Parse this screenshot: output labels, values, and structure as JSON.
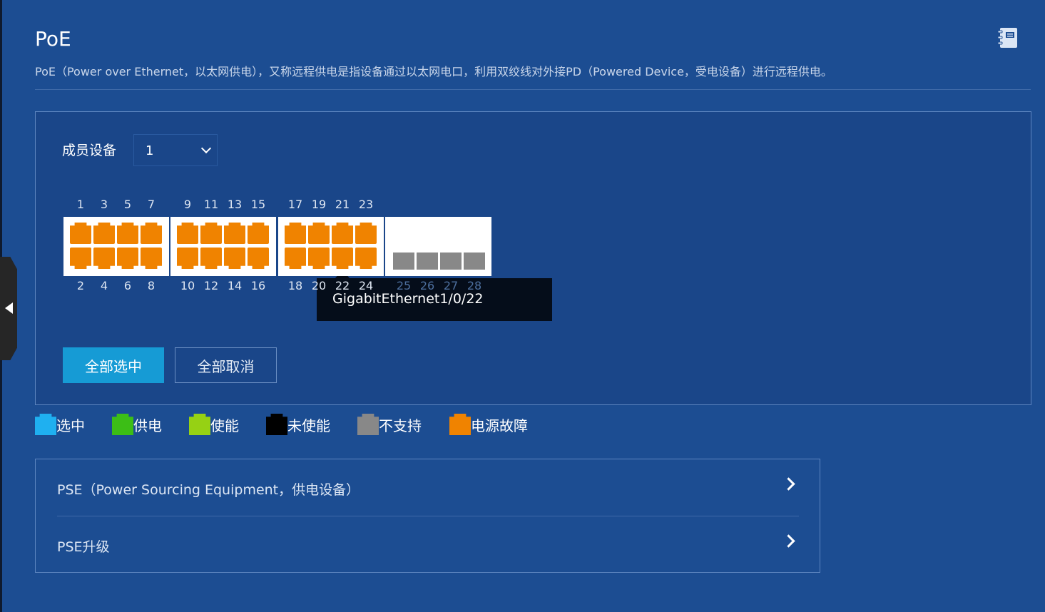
{
  "header": {
    "title": "PoE",
    "description": "PoE（Power over Ethernet，以太网供电），又称远程供电是指设备通过以太网电口，利用双绞线对外接PD（Powered Device，受电设备）进行远程供电。",
    "help_icon": "notebook-icon"
  },
  "member": {
    "label": "成员设备",
    "selected": "1"
  },
  "ports": {
    "top_numbers": [
      "1",
      "3",
      "5",
      "7",
      "9",
      "11",
      "13",
      "15",
      "17",
      "19",
      "21",
      "23"
    ],
    "bottom_numbers": [
      "2",
      "4",
      "6",
      "8",
      "10",
      "12",
      "14",
      "16",
      "18",
      "20",
      "22",
      "24"
    ],
    "sfp_numbers": [
      "25",
      "26",
      "27",
      "28"
    ],
    "copper_status": "电源故障",
    "sfp_status": "不支持"
  },
  "tooltip": {
    "text": "GigabitEthernet1/0/22"
  },
  "buttons": {
    "select_all": "全部选中",
    "cancel_all": "全部取消"
  },
  "legend": [
    {
      "label": "选中",
      "color": "#1fb0f0"
    },
    {
      "label": "供电",
      "color": "#3cbe16"
    },
    {
      "label": "使能",
      "color": "#96d114"
    },
    {
      "label": "未使能",
      "color": "#000000"
    },
    {
      "label": "不支持",
      "color": "#888888"
    },
    {
      "label": "电源故障",
      "color": "#f08300"
    }
  ],
  "accordion": {
    "pse": "PSE（Power Sourcing Equipment，供电设备）",
    "pse_upgrade": "PSE升级"
  },
  "colors": {
    "background": "#1c4d92",
    "panel": "#1a4689",
    "port_fault": "#f08300",
    "port_unsupported": "#888888",
    "accent": "#169bd5"
  }
}
